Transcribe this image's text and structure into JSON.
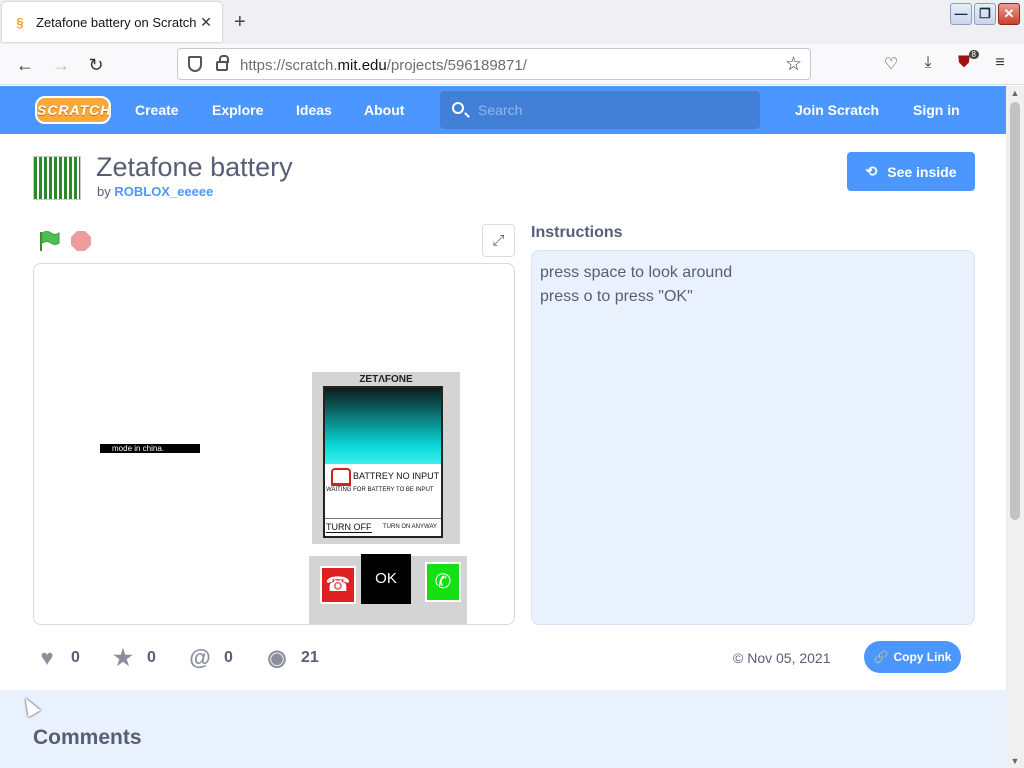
{
  "browser": {
    "tab_title": "Zetafone battery on Scratch",
    "tab_close": "✕",
    "new_tab": "+",
    "url_prefix": "https://scratch.",
    "url_domain": "mit.edu",
    "url_path": "/projects/596189871/",
    "extension_badge": "8",
    "window_controls": {
      "minimize": "—",
      "maximize": "❐",
      "close": "✕"
    }
  },
  "header": {
    "logo": "SCRATCH",
    "nav": [
      "Create",
      "Explore",
      "Ideas",
      "About"
    ],
    "search_placeholder": "Search",
    "join": "Join Scratch",
    "signin": "Sign in"
  },
  "project": {
    "title": "Zetafone battery",
    "by_label": "by",
    "author": "ROBLOX_eeeee",
    "see_inside": "See inside",
    "stage": {
      "made_in": "mode in china.",
      "brand": "ZETΛFONE",
      "warning_text": "BATTREY NO INPUT",
      "waiting_text": "WAITING FOR BATTERY TO BE INPUT",
      "turn_off": "TURN OFF",
      "turn_on": "TURN ON ANYWAY",
      "ok_key": "OK"
    },
    "instructions_title": "Instructions",
    "instructions": [
      "press space to look around",
      "press o to press \"OK\""
    ],
    "stats": {
      "loves": "0",
      "favorites": "0",
      "remixes": "0",
      "views": "21"
    },
    "date": "© Nov 05, 2021",
    "copy_link": "Copy Link"
  },
  "comments": {
    "title": "Comments"
  },
  "colors": {
    "scratch_blue": "#4c97ff",
    "header_blue": "#4c97ff",
    "instructions_bg": "#e9f1fc"
  }
}
